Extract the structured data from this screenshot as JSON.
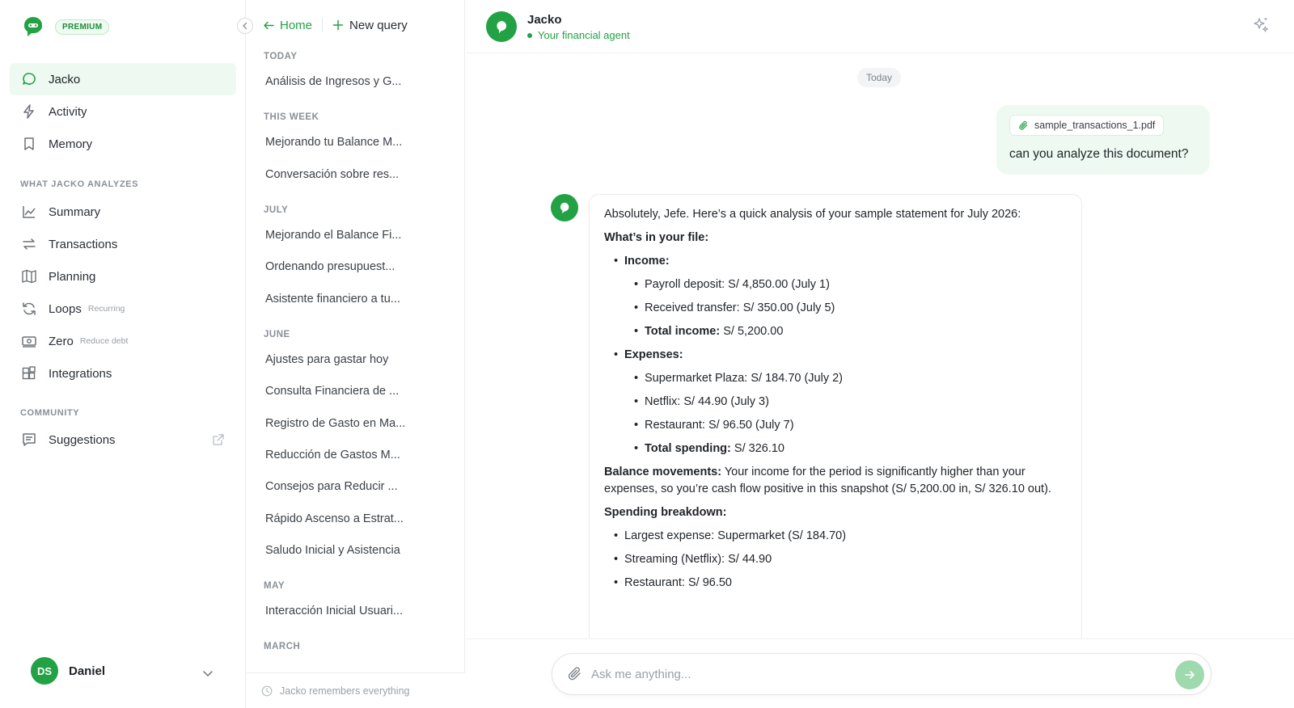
{
  "brand": {
    "badge": "PREMIUM",
    "accent": "#22a244"
  },
  "sidebar": {
    "items": [
      {
        "label": "Jacko",
        "icon": "chat-bubble-icon"
      },
      {
        "label": "Activity",
        "icon": "lightning-icon"
      },
      {
        "label": "Memory",
        "icon": "bookmark-icon"
      }
    ],
    "analyze_label": "WHAT JACKO ANALYZES",
    "analyze_items": [
      {
        "label": "Summary",
        "icon": "line-chart-icon",
        "sub": ""
      },
      {
        "label": "Transactions",
        "icon": "swap-arrows-icon",
        "sub": ""
      },
      {
        "label": "Planning",
        "icon": "map-icon",
        "sub": ""
      },
      {
        "label": "Loops",
        "icon": "refresh-icon",
        "sub": "Recurring"
      },
      {
        "label": "Zero",
        "icon": "banknote-icon",
        "sub": "Reduce debt"
      },
      {
        "label": "Integrations",
        "icon": "grid-plus-icon",
        "sub": ""
      }
    ],
    "community_label": "COMMUNITY",
    "community_items": [
      {
        "label": "Suggestions",
        "icon": "message-square-icon"
      }
    ],
    "user": {
      "initials": "DS",
      "name": "Daniel"
    }
  },
  "history": {
    "home": "Home",
    "new_query": "New query",
    "groups": [
      {
        "label": "TODAY",
        "items": [
          "Análisis de Ingresos y G..."
        ]
      },
      {
        "label": "THIS WEEK",
        "items": [
          "Mejorando tu Balance M...",
          "Conversación sobre res..."
        ]
      },
      {
        "label": "JULY",
        "items": [
          "Mejorando el Balance Fi...",
          "Ordenando presupuest...",
          "Asistente financiero a tu..."
        ]
      },
      {
        "label": "JUNE",
        "items": [
          "Ajustes para gastar hoy",
          "Consulta Financiera de ...",
          "Registro de Gasto en Ma...",
          "Reducción de Gastos M...",
          "Consejos para Reducir ...",
          "Rápido Ascenso a Estrat...",
          "Saludo Inicial y Asistencia"
        ]
      },
      {
        "label": "MAY",
        "items": [
          "Interacción Inicial Usuari..."
        ]
      },
      {
        "label": "MARCH",
        "items": []
      }
    ],
    "footer": "Jacko remembers everything"
  },
  "chat": {
    "agent_name": "Jacko",
    "agent_status": "Your financial agent",
    "day": "Today",
    "user_message": {
      "attachment": "sample_transactions_1.pdf",
      "text": "can you analyze this document?"
    },
    "reply": {
      "intro": "Absolutely, Jefe. Here’s a quick analysis of your sample statement for July 2026:",
      "file_heading": "What’s in your file:",
      "income_label": "Income:",
      "income": [
        "Payroll deposit: S/ 4,850.00 (July 1)",
        "Received transfer: S/ 350.00 (July 5)"
      ],
      "income_total_label": "Total income:",
      "income_total": " S/ 5,200.00",
      "expenses_label": "Expenses:",
      "expenses": [
        "Supermarket Plaza: S/ 184.70 (July 2)",
        "Netflix: S/ 44.90 (July 3)",
        "Restaurant: S/ 96.50 (July 7)"
      ],
      "spending_total_label": "Total spending:",
      "spending_total": " S/ 326.10",
      "balance_label": "Balance movements:",
      "balance_text": " Your income for the period is significantly higher than your expenses, so you’re cash flow positive in this snapshot (S/ 5,200.00 in, S/ 326.10 out).",
      "breakdown_heading": "Spending breakdown:",
      "breakdown": [
        "Largest expense: Supermarket (S/ 184.70)",
        "Streaming (Netflix): S/ 44.90",
        "Restaurant: S/ 96.50"
      ]
    },
    "composer_placeholder": "Ask me anything..."
  }
}
